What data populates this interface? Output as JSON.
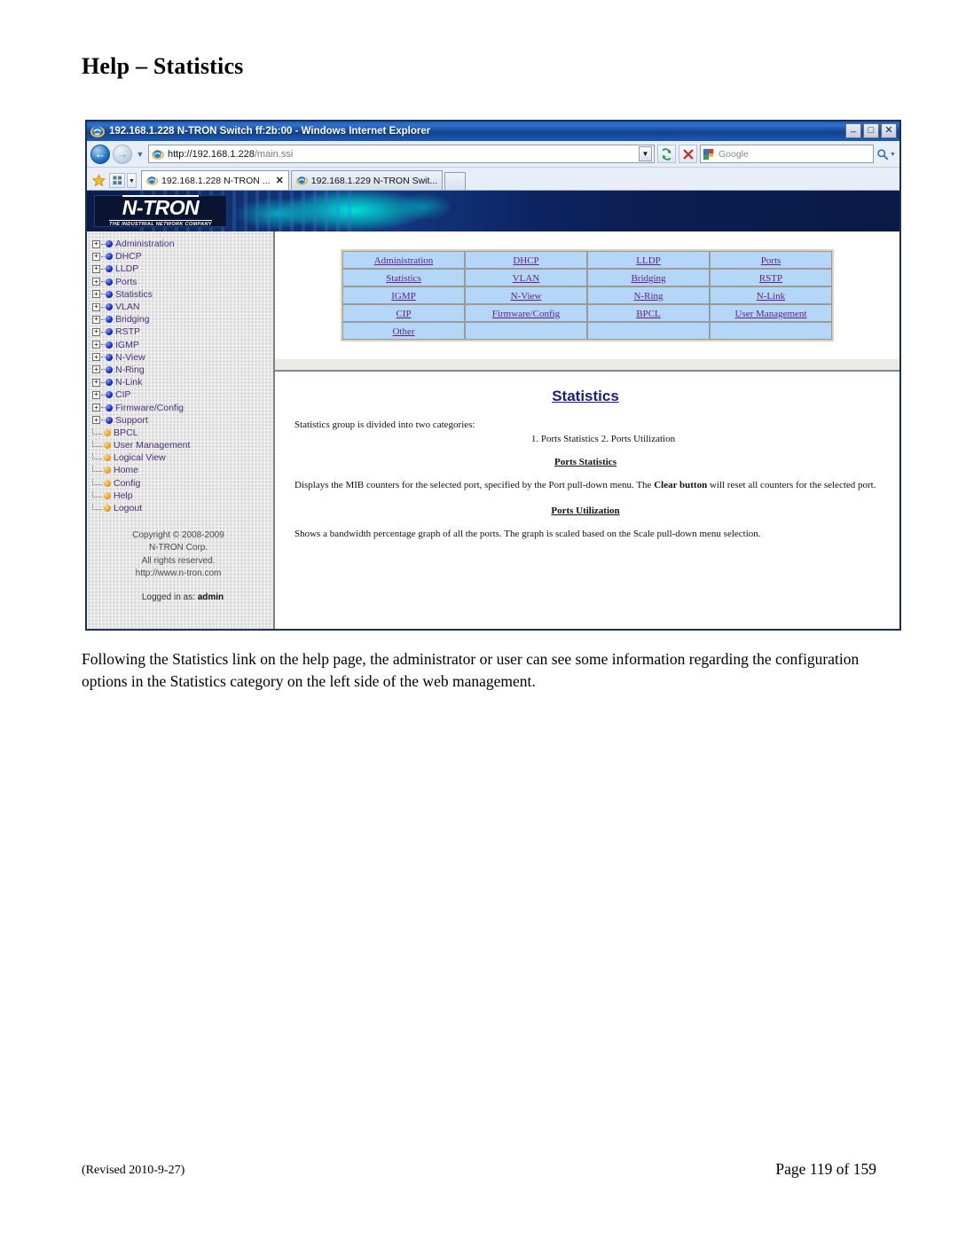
{
  "document": {
    "heading": "Help – Statistics",
    "body_paragraph": "Following the Statistics link on the help page, the administrator or user can see some information regarding the configuration options in the Statistics category on the left side of the web management.",
    "footer_left": "(Revised 2010-9-27)",
    "footer_right": "Page 119 of 159"
  },
  "browser": {
    "title": "192.168.1.228 N-TRON Switch ff:2b:00 - Windows Internet Explorer",
    "window_buttons": {
      "minimize": "_",
      "maximize": "□",
      "close": "✕"
    },
    "address": {
      "url_protocol_host": "http://192.168.1.228",
      "url_path": "/main.ssi",
      "full_url": "http://192.168.1.228/main.ssi"
    },
    "search": {
      "placeholder": "Google"
    },
    "tabs": [
      {
        "label": "192.168.1.228 N-TRON ...",
        "active": true,
        "close": "✕"
      },
      {
        "label": "192.168.1.229 N-TRON Swit...",
        "active": false
      }
    ]
  },
  "logo": {
    "name": "N-TRON",
    "tagline": "THE INDUSTRIAL NETWORK COMPANY"
  },
  "sidebar": {
    "expandable": [
      {
        "label": "Administration"
      },
      {
        "label": "DHCP"
      },
      {
        "label": "LLDP"
      },
      {
        "label": "Ports"
      },
      {
        "label": "Statistics"
      },
      {
        "label": "VLAN"
      },
      {
        "label": "Bridging"
      },
      {
        "label": "RSTP"
      },
      {
        "label": "IGMP"
      },
      {
        "label": "N-View"
      },
      {
        "label": "N-Ring"
      },
      {
        "label": "N-Link"
      },
      {
        "label": "CIP"
      },
      {
        "label": "Firmware/Config"
      },
      {
        "label": "Support"
      }
    ],
    "leaves": [
      {
        "label": "BPCL"
      },
      {
        "label": "User Management"
      },
      {
        "label": "Logical View"
      },
      {
        "label": "Home"
      },
      {
        "label": "Config"
      },
      {
        "label": "Help"
      },
      {
        "label": "Logout"
      }
    ],
    "expand_glyph": "+",
    "copyright": [
      "Copyright © 2008-2009",
      "N-TRON Corp.",
      "All rights reserved.",
      "http://www.n-tron.com"
    ],
    "logged_in_prefix": "Logged in as:",
    "logged_in_user": "admin"
  },
  "help_links": {
    "rows": [
      [
        "Administration",
        "DHCP",
        "LLDP",
        "Ports"
      ],
      [
        "Statistics",
        "VLAN",
        "Bridging",
        "RSTP"
      ],
      [
        "IGMP",
        "N-View",
        "N-Ring",
        "N-Link"
      ],
      [
        "CIP",
        "Firmware/Config",
        "BPCL",
        "User Management"
      ],
      [
        "Other",
        "",
        "",
        ""
      ]
    ]
  },
  "help_content": {
    "title": "Statistics",
    "intro": "Statistics group is divided into two categories:",
    "categories": "1. Ports Statistics   2. Ports Utilization",
    "section1_title": "Ports Statistics",
    "section1_text_a": "Displays the MIB counters for the selected port, specified by the Port pull-down menu. The ",
    "section1_bold": "Clear button",
    "section1_text_b": " will reset all counters for the selected port.",
    "section2_title": "Ports Utilization",
    "section2_text": "Shows a bandwidth percentage graph of all the ports. The graph is scaled based on the Scale pull-down menu selection."
  },
  "colors": {
    "titlebar_blue": "#12428f",
    "banner_navy": "#0d1f52",
    "banner_cyan": "#00ebe1",
    "link_purple": "#5f1f8c",
    "help_title_blue": "#1c1c8c",
    "cell_blue": "#b5d7f7",
    "sidebar_gray": "#dcdcdc"
  }
}
